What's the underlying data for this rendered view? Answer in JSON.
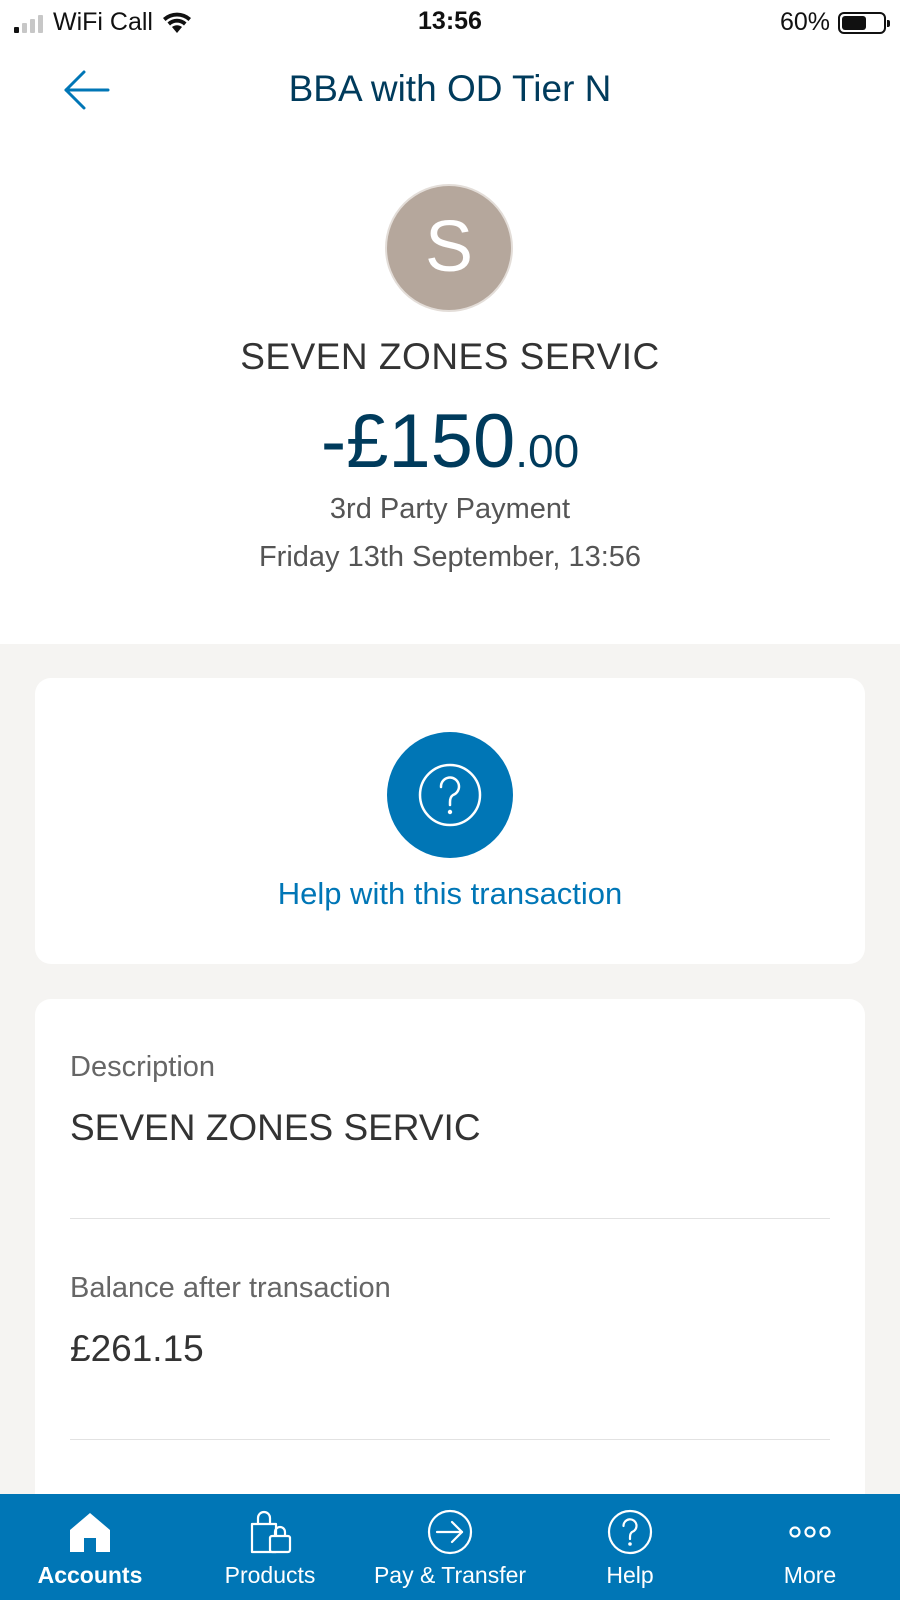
{
  "status_bar": {
    "carrier": "WiFi Call",
    "time": "13:56",
    "battery": "60%",
    "battery_level": 0.6
  },
  "header": {
    "title": "BBA with OD Tier N",
    "back_icon": "arrow-left-icon"
  },
  "transaction": {
    "avatar_letter": "S",
    "merchant": "SEVEN ZONES SERVIC",
    "amount_main": "-£150",
    "amount_pence": ".00",
    "type": "3rd Party Payment",
    "datetime": "Friday 13th September, 13:56"
  },
  "help": {
    "icon": "question-circle-icon",
    "label": "Help with this transaction"
  },
  "details": {
    "description_label": "Description",
    "description_value": "SEVEN ZONES SERVIC",
    "balance_label": "Balance after transaction",
    "balance_value": "£261.15"
  },
  "tabs": [
    {
      "label": "Accounts",
      "icon": "home-icon",
      "active": true
    },
    {
      "label": "Products",
      "icon": "shopping-bag-icon",
      "active": false
    },
    {
      "label": "Pay & Transfer",
      "icon": "arrow-circle-icon",
      "active": false
    },
    {
      "label": "Help",
      "icon": "question-circle-icon",
      "active": false
    },
    {
      "label": "More",
      "icon": "more-dots-icon",
      "active": false
    }
  ],
  "colors": {
    "brand_blue": "#0076b6",
    "title_navy": "#003b5c",
    "avatar_bg": "#b5a79c"
  }
}
